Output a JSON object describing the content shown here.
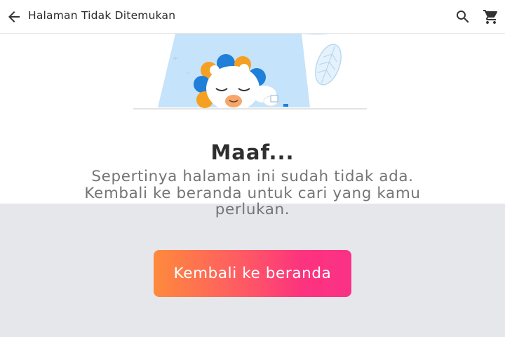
{
  "header": {
    "title": "Halaman Tidak Ditemukan",
    "back_icon": "arrow-back-icon",
    "search_icon": "search-icon",
    "cart_icon": "shopping-cart-icon"
  },
  "content": {
    "heading": "Maaf...",
    "message": "Sepertinya halaman ini sudah tidak ada. Kembali ke beranda untuk cari yang kamu perlukan.",
    "button_label": "Kembali ke beranda"
  },
  "illustration": {
    "subject": "sleeping lion mascot under spotlight",
    "colors": {
      "mane_blue": "#1f7fd9",
      "mane_orange": "#f5a022",
      "light_beam": "#c5e3fa"
    }
  },
  "colors": {
    "accent_start": "#fe8a3c",
    "accent_end": "#fb3186",
    "lower_background": "#e6e7eb"
  }
}
